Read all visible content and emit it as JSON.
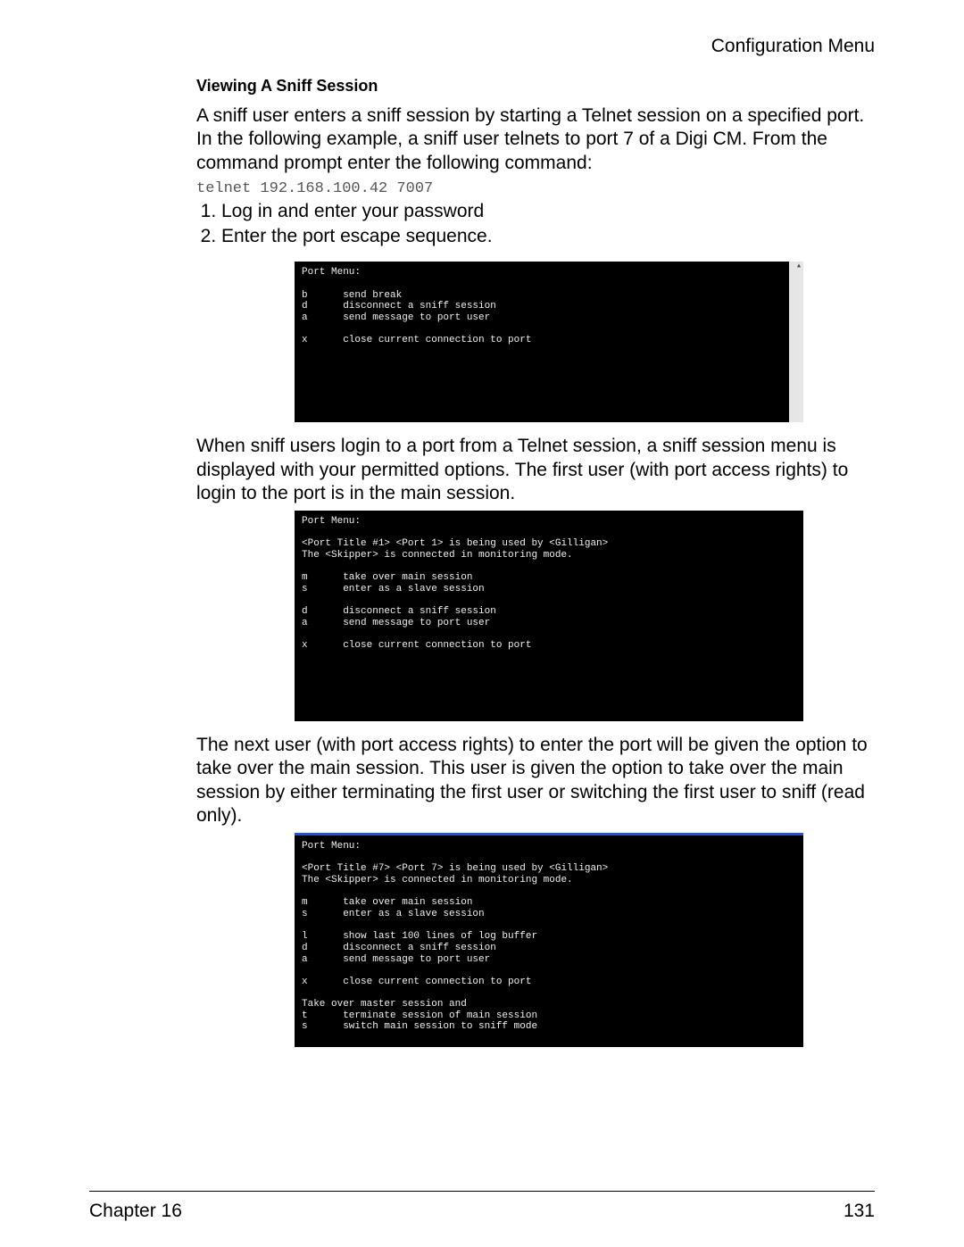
{
  "header": {
    "right": "Configuration Menu"
  },
  "section_title": "Viewing A Sniff Session",
  "para_intro": "A sniff user enters a sniff session by starting a Telnet session on a specified port. In the following example, a sniff user telnets to port 7 of a Digi CM. From the command prompt enter the following command:",
  "telnet_cmd": "telnet 192.168.100.42 7007",
  "steps": [
    "Log in and enter your password",
    "Enter the port escape sequence."
  ],
  "terminal1": "Port Menu:\n\nb      send break\nd      disconnect a sniff session\na      send message to port user\n\nx      close current connection to port",
  "para_after1": "When sniff users login to a port from a Telnet session, a sniff session menu is displayed with your permitted options. The first user (with port access rights) to login to the port is in the main session.",
  "terminal2": "Port Menu:\n\n<Port Title #1> <Port 1> is being used by <Gilligan>\nThe <Skipper> is connected in monitoring mode.\n\nm      take over main session\ns      enter as a slave session\n\nd      disconnect a sniff session\na      send message to port user\n\nx      close current connection to port",
  "para_after2": "The next user (with port access rights) to enter the port will be given the option to take over the main session. This user is given the option to take over the main session by either terminating the first user or switching the first user to sniff (read only).",
  "terminal3": "Port Menu:\n\n<Port Title #7> <Port 7> is being used by <Gilligan>\nThe <Skipper> is connected in monitoring mode.\n\nm      take over main session\ns      enter as a slave session\n\nl      show last 100 lines of log buffer\nd      disconnect a sniff session\na      send message to port user\n\nx      close current connection to port\n\nTake over master session and\nt      terminate session of main session\ns      switch main session to sniff mode",
  "footer": {
    "chapter": "Chapter 16",
    "page": "131"
  }
}
